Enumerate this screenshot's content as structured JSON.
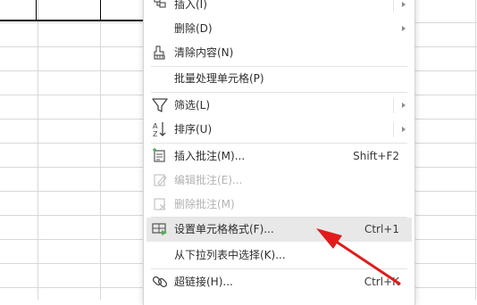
{
  "menu": {
    "items": [
      {
        "label": "插入(I)",
        "icon": "insert-icon",
        "submenu": true
      },
      {
        "label": "删除(D)",
        "icon": "",
        "submenu": true
      },
      {
        "label": "清除内容(N)",
        "icon": "eraser-icon",
        "submenu": false
      },
      {
        "label": "批量处理单元格(P)",
        "icon": "",
        "submenu": false
      },
      {
        "label": "筛选(L)",
        "icon": "filter-icon",
        "submenu": true
      },
      {
        "label": "排序(U)",
        "icon": "sort-az-icon",
        "submenu": true
      },
      {
        "label": "插入批注(M)...",
        "icon": "insert-comment-icon",
        "shortcut": "Shift+F2",
        "submenu": false
      },
      {
        "label": "编辑批注(E)...",
        "icon": "edit-comment-icon",
        "disabled": true
      },
      {
        "label": "删除批注(M)",
        "icon": "delete-comment-icon",
        "disabled": true
      },
      {
        "label": "设置单元格格式(F)...",
        "icon": "format-cells-icon",
        "shortcut": "Ctrl+1",
        "highlighted": true
      },
      {
        "label": "从下拉列表中选择(K)...",
        "icon": ""
      },
      {
        "label": "超链接(H)...",
        "icon": "link-icon",
        "shortcut": "Ctrl+K"
      }
    ]
  },
  "colors": {
    "annotation_arrow": "#e01b1b",
    "icon_green": "#4caf50",
    "highlight": "#e8e8e8"
  }
}
